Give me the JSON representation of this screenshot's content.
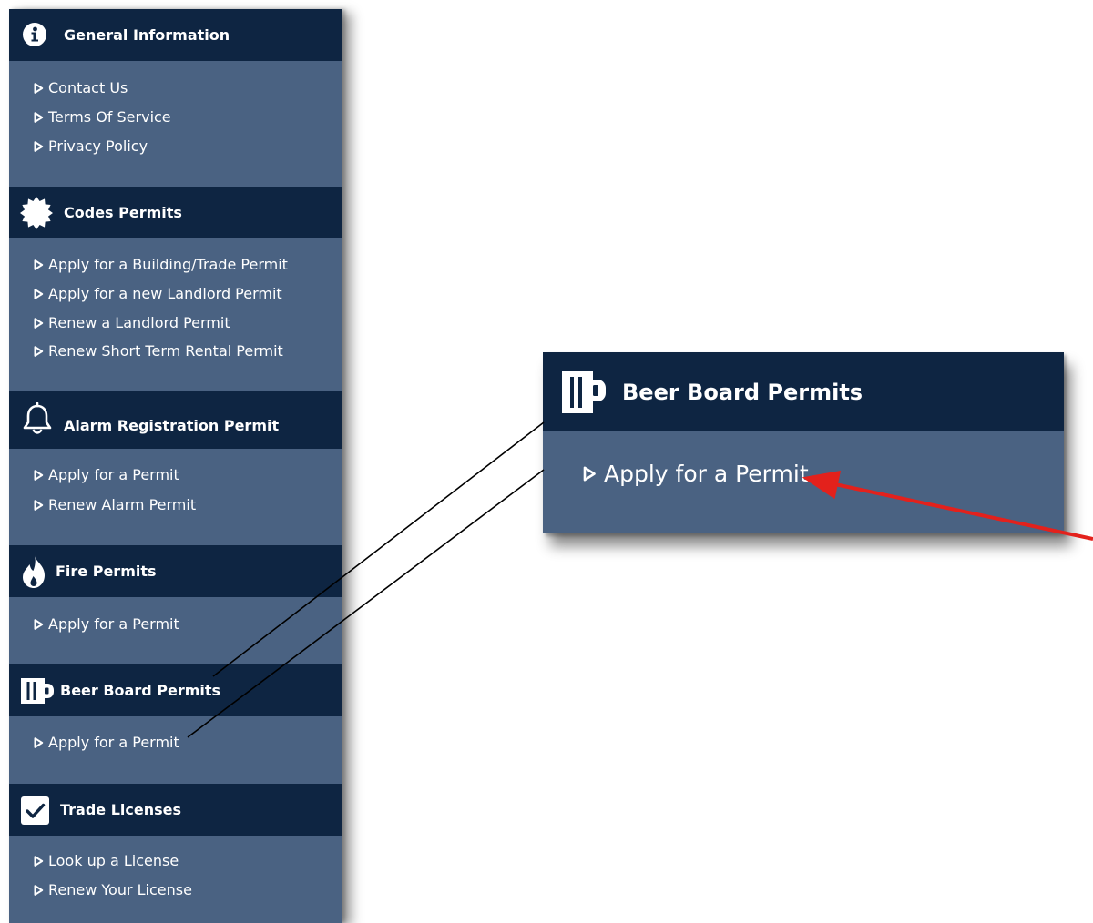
{
  "colors": {
    "header_bg": "#0e2542",
    "body_bg": "#4a6282",
    "text": "#ffffff",
    "arrow": "#e3211c",
    "connector": "#000000"
  },
  "sidebar": {
    "sections": [
      {
        "icon": "info-icon",
        "title": "General Information",
        "items": [
          "Contact Us",
          "Terms Of Service",
          "Privacy Policy"
        ]
      },
      {
        "icon": "badge-gear-icon",
        "title": "Codes Permits",
        "items": [
          "Apply for a Building/Trade Permit",
          "Apply for a new Landlord Permit",
          "Renew a Landlord Permit",
          "Renew Short Term Rental Permit"
        ]
      },
      {
        "icon": "bell-icon",
        "title": "Alarm Registration Permit",
        "items": [
          "Apply for a Permit",
          "Renew Alarm Permit"
        ]
      },
      {
        "icon": "fire-icon",
        "title": "Fire Permits",
        "items": [
          "Apply for a Permit"
        ]
      },
      {
        "icon": "beer-mug-icon",
        "title": "Beer Board Permits",
        "items": [
          "Apply for a Permit"
        ]
      },
      {
        "icon": "checkbox-checked-icon",
        "title": "Trade Licenses",
        "items": [
          "Look up a License",
          "Renew Your License"
        ]
      }
    ]
  },
  "callout": {
    "icon": "beer-mug-icon",
    "title": "Beer Board Permits",
    "item": "Apply for a Permit"
  }
}
